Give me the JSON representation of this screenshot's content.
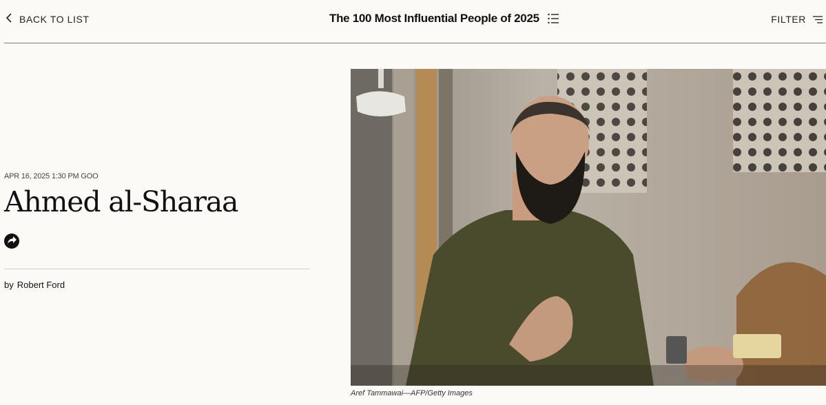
{
  "header": {
    "back_label": "BACK TO LIST",
    "list_title": "The 100 Most Influential People of 2025",
    "filter_label": "FILTER"
  },
  "article": {
    "dateline": "APR 16, 2025 1:30 PM GOO",
    "title": "Ahmed al-Sharaa",
    "byline_prefix": "by",
    "author": "Robert Ford"
  },
  "photo": {
    "caption": "Aref Tammawai—AFP/Getty Images"
  },
  "icons": {
    "back": "chevron-left-icon",
    "list": "list-icon",
    "filter": "filter-lines-icon",
    "share": "share-arrow-icon"
  },
  "colors": {
    "background": "#fbfaf6",
    "text": "#111111",
    "rule": "#7a7a7a"
  }
}
